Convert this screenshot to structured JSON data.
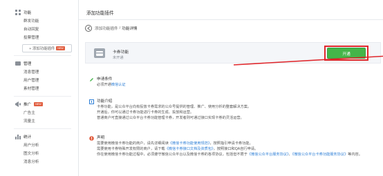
{
  "sidebar": {
    "functions": {
      "title": "功能",
      "items": [
        "群发功能",
        "自动回复",
        "投票管理"
      ]
    },
    "add_plugin": {
      "label": "+ 添加功能插件",
      "badge": "NEW"
    },
    "manage": {
      "title": "管理",
      "items": [
        "消息管理",
        "用户管理",
        "素材管理"
      ]
    },
    "promote": {
      "title": "推广",
      "badge": "NEW",
      "items": [
        "广告主",
        "流量主"
      ]
    },
    "stats": {
      "title": "统计",
      "items": [
        "用户分析",
        "图文分析",
        "消息分析"
      ]
    }
  },
  "main": {
    "page_title": "添加功能插件",
    "breadcrumb": {
      "parent": "添加功能插件",
      "separator": "/",
      "current": "功能详情"
    },
    "plugin": {
      "name": "卡券功能",
      "status": "未开通",
      "open_label": "开通"
    },
    "requirement": {
      "heading": "申请条件",
      "text_prefix": "必须开通",
      "link": "微信认证"
    },
    "intro": {
      "heading": "功能介绍",
      "lines": [
        "卡券功能，是公众平台向有投放卡券需求的公众号提供的管理、推广、使用分析的整套解决方案。",
        "开通后，你可以通过卡券功能进行卡券的生成、投放和运营。",
        "普通商户可直接通过公众平台卡券功能管理卡券，开发者则可通过接口实现卡券的灵活运营。"
      ]
    },
    "statement": {
      "heading": "声明",
      "line1_prefix": "需要使用微信卡券功能的商户，请先详细阅读",
      "line1_link": "《微信卡券功能使用规范》",
      "line1_suffix": "，按照指引申请卡券功能。",
      "line2_prefix": "需要使用卡券特殊开发权限的商户，请下载",
      "line2_link": "《微信卡券接口文档及资质包》",
      "line2_suffix": "，按照接口和QA自行申请。",
      "line3_prefix": "你在使用微信卡券功能过程中，必须遵守微信公众平台以及微信卡券的各项协议，包括但不限于",
      "line3_link1": "《微信公众平台服务协议》",
      "line3_sep": "、",
      "line3_link2": "《微信公众平台卡券功能服务协议》",
      "line3_suffix": "等内容。"
    }
  },
  "colors": {
    "accent_green": "#44b549",
    "highlight_red": "#e0262b",
    "link_blue": "#2e7fd6"
  },
  "icons": [
    "grid-icon",
    "folder-icon",
    "megaphone-icon",
    "chart-icon",
    "back-icon",
    "pencil-icon",
    "info-icon",
    "alert-icon",
    "card-icon"
  ]
}
